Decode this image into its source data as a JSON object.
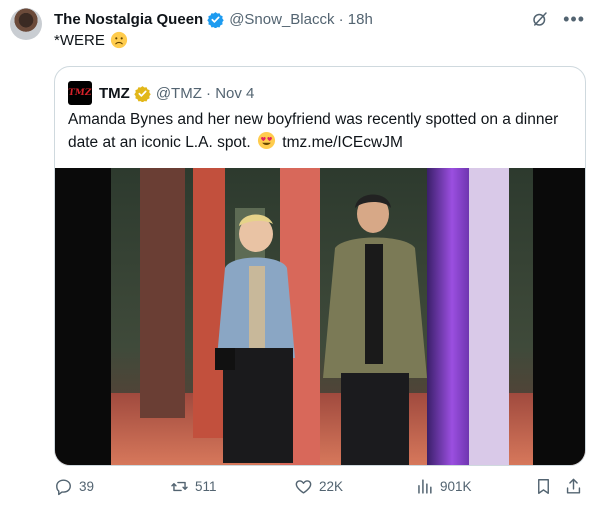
{
  "tweet": {
    "display_name": "The Nostalgia Queen",
    "handle_time": "@Snow_Blacck · 18h",
    "text": "*WERE",
    "emoji": "frowning-face"
  },
  "quote": {
    "name": "TMZ",
    "logo_text": "TMZ",
    "handle_date": "@TMZ · Nov 4",
    "text": "Amanda Bynes and her new boyfriend was recently spotted on a dinner date at an iconic L.A. spot.",
    "emoji": "smiling-face-with-heart-eyes",
    "link": "tmz.me/ICEcwJM"
  },
  "actions": {
    "replies": "39",
    "reposts": "511",
    "likes": "22K",
    "views": "901K"
  },
  "colors": {
    "verified_blue": "#1d9bf0",
    "verified_gold": "#e2b719",
    "muted_text": "#536471",
    "border": "#cfd9de"
  }
}
